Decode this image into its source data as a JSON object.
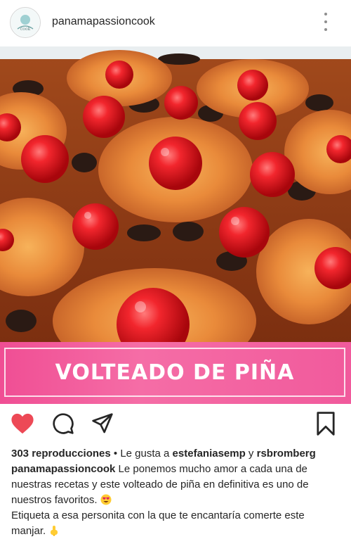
{
  "post": {
    "username": "panamapassioncook",
    "banner_text": "VOLTEADO DE PIÑA",
    "views": "303 reproducciones",
    "likes_prefix": " • Le gusta a ",
    "liker1": "estefaniasemp",
    "likes_and": " y ",
    "liker2": "rsbromberg",
    "caption_user": "panamapassioncook",
    "caption_text": " Le ponemos mucho amor a cada una de nuestras recetas y este volteado de piña en definitiva es uno de nuestros favoritos.",
    "caption_text2": "Etiqueta a esa personita con la que te encantaría comerte este manjar.",
    "liked": true
  },
  "colors": {
    "heart": "#ed4956",
    "banner": "#f04e94"
  },
  "icons": [
    "heart-icon",
    "comment-icon",
    "share-icon",
    "bookmark-icon",
    "more-icon"
  ]
}
